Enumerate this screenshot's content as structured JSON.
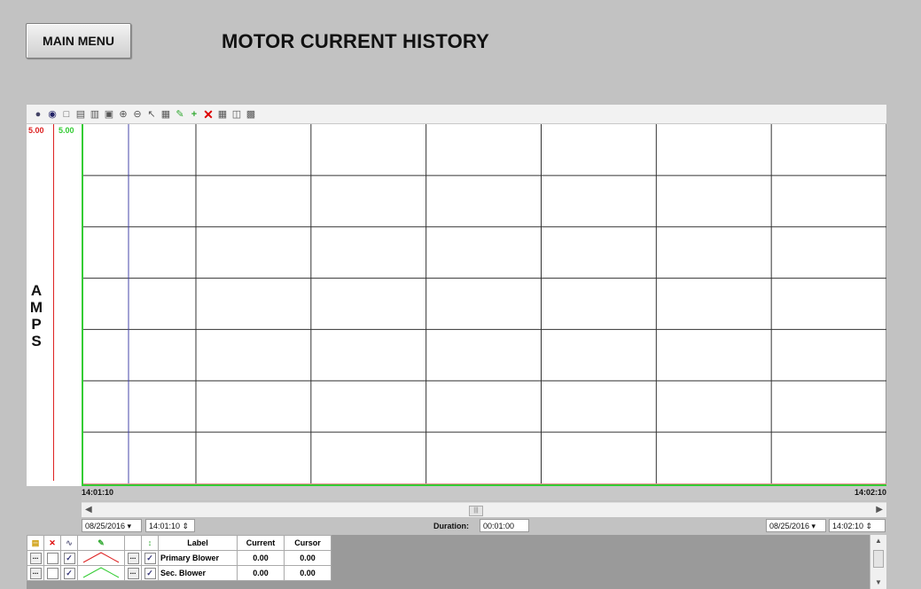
{
  "header": {
    "main_menu_label": "MAIN MENU",
    "title": "MOTOR CURRENT HISTORY"
  },
  "toolbar_icons": [
    "play-icon",
    "pause-icon",
    "zoom-box-icon",
    "zoom-x-icon",
    "zoom-y-icon",
    "zoom-fit-icon",
    "zoom-in-icon",
    "zoom-out-icon",
    "cursor-icon",
    "legend-icon",
    "pen-icon",
    "add-icon",
    "delete-icon",
    "grid-icon",
    "layout-icon",
    "export-icon"
  ],
  "chart": {
    "y_max_labels": [
      "5.00",
      "5.00"
    ],
    "y_label_letters": [
      "A",
      "M",
      "P",
      "S"
    ],
    "x_start_label": "14:01:10",
    "x_end_label": "14:02:10",
    "grid_rows": 7,
    "grid_cols": 7
  },
  "range": {
    "start_date": "08/25/2016",
    "start_time": "14:01:10",
    "duration_label": "Duration:",
    "duration_value": "00:01:00",
    "end_date": "08/25/2016",
    "end_time": "14:02:10"
  },
  "legend": {
    "headers": {
      "label": "Label",
      "current": "Current",
      "cursor": "Cursor"
    },
    "rows": [
      {
        "label": "Primary Blower",
        "current": "0.00",
        "cursor": "0.00",
        "color": "#d22"
      },
      {
        "label": "Sec. Blower",
        "current": "0.00",
        "cursor": "0.00",
        "color": "#3c3"
      }
    ]
  },
  "colors": {
    "pen1": "#d22",
    "pen2": "#3c3",
    "cursor_line": "#4444aa"
  }
}
